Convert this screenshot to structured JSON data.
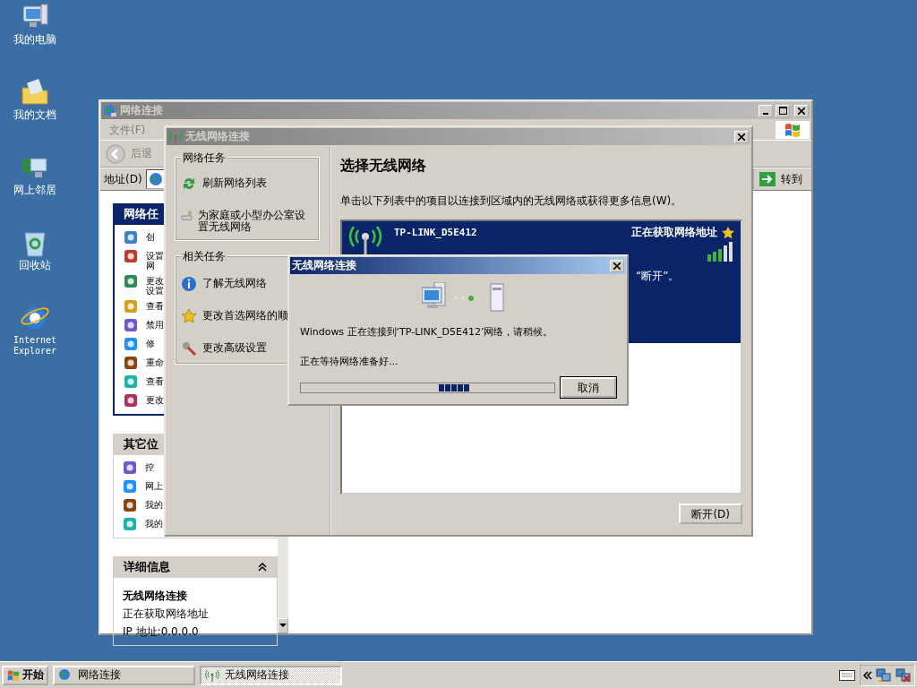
{
  "desktop": {
    "icons": [
      {
        "label": "我的电脑"
      },
      {
        "label": "我的文档"
      },
      {
        "label": "网上邻居"
      },
      {
        "label": "回收站"
      },
      {
        "label": "Internet Explorer"
      }
    ]
  },
  "network_connections_window": {
    "title": "网络连接",
    "menu": [
      "文件(F)"
    ],
    "back_button": "后退",
    "address_label": "地址(D)",
    "go_button": "转到",
    "task_panels": [
      {
        "title": "网络任",
        "items": [
          "创",
          "设置网",
          "更改设置",
          "查看",
          "禁用",
          "修",
          "重命",
          "查看",
          "更改"
        ]
      },
      {
        "title": "其它位",
        "items": [
          "控",
          "网上",
          "我的",
          "我的"
        ]
      }
    ],
    "details": {
      "title": "详细信息",
      "name": "无线网络连接",
      "status": "正在获取网络地址",
      "ip": "IP 地址:0.0.0.0"
    }
  },
  "wireless_window": {
    "title": "无线网络连接",
    "task_groups": [
      {
        "title": "网络任务",
        "items": [
          "刷新网络列表",
          "为家庭或小型办公室设置无线网络"
        ]
      },
      {
        "title": "相关任务",
        "items": [
          "了解无线网络",
          "更改首选网络的顺",
          "更改高级设置"
        ]
      }
    ],
    "heading": "选择无线网络",
    "description": "单击以下列表中的项目以连接到区域内的无线网络或获得更多信息(W)。",
    "networks": [
      {
        "name": "TP-LINK_D5E412",
        "status": "正在获取网络地址",
        "note": "“断开”。",
        "selected": true
      }
    ],
    "disconnect_button": "断开(D)"
  },
  "connect_dialog": {
    "title": "无线网络连接",
    "message": "Windows 正在连接到‘TP-LINK_D5E412’网络，请稍候。",
    "status": "正在等待网络准备好...",
    "cancel_button": "取消"
  },
  "taskbar": {
    "start": "开始",
    "tasks": [
      {
        "label": "网络连接",
        "selected": false
      },
      {
        "label": "无线网络连接",
        "selected": true
      }
    ]
  }
}
